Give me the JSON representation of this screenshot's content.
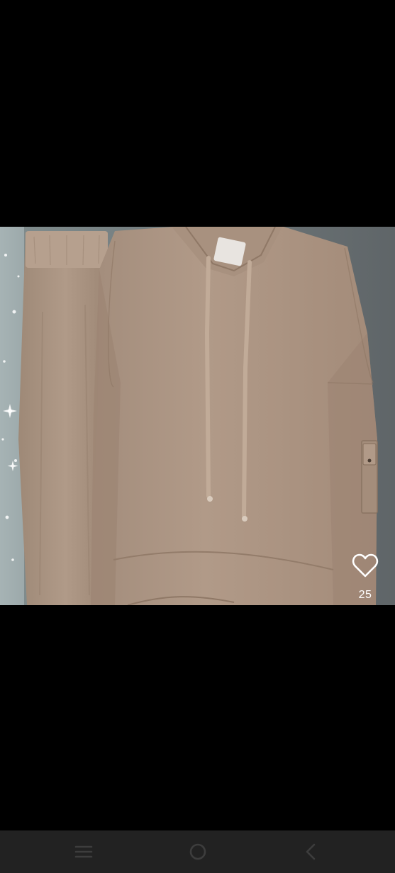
{
  "photo": {
    "subject": "beige-hoodie-and-skirt-set"
  },
  "like": {
    "icon": "heart-outline-icon",
    "count": "25",
    "color": "#ffffff"
  },
  "navigation_bar": {
    "background": "#222222",
    "icon_color": "#3d3d3d",
    "buttons": [
      "recent-apps-icon",
      "home-icon",
      "back-icon"
    ]
  }
}
